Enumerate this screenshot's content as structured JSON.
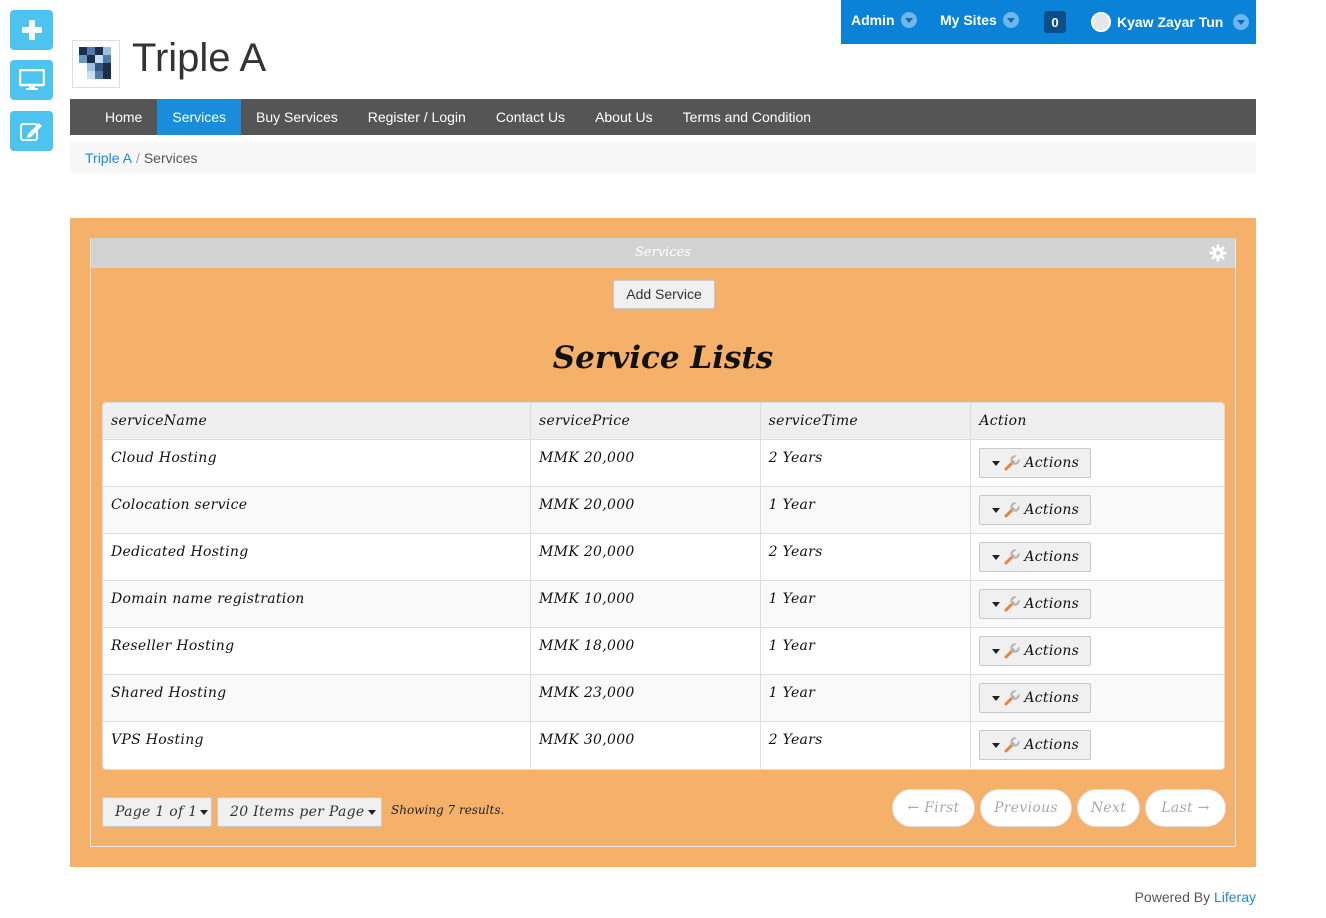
{
  "dock": {
    "add_icon": "plus-icon",
    "preview_icon": "monitor-icon",
    "edit_icon": "edit-icon"
  },
  "topbar": {
    "admin": "Admin",
    "my_sites": "My Sites",
    "notifications": "0",
    "user": "Kyaw Zayar Tun"
  },
  "site": {
    "title": "Triple A"
  },
  "nav": {
    "items": [
      "Home",
      "Services",
      "Buy Services",
      "Register / Login",
      "Contact Us",
      "About Us",
      "Terms and Condition"
    ],
    "active": "Services"
  },
  "breadcrumb": {
    "home": "Triple A",
    "separator": "/",
    "current": "Services"
  },
  "portlet": {
    "title": "Services",
    "add_button": "Add Service",
    "list_title": "Service Lists",
    "columns": [
      "serviceName",
      "servicePrice",
      "serviceTime",
      "Action"
    ],
    "rows": [
      {
        "name": "Cloud Hosting",
        "price": "MMK 20,000",
        "time": "2 Years"
      },
      {
        "name": "Colocation service",
        "price": "MMK 20,000",
        "time": "1 Year"
      },
      {
        "name": "Dedicated Hosting",
        "price": "MMK 20,000",
        "time": "2 Years"
      },
      {
        "name": "Domain name registration",
        "price": "MMK 10,000",
        "time": "1 Year"
      },
      {
        "name": "Reseller Hosting",
        "price": "MMK 18,000",
        "time": "1 Year"
      },
      {
        "name": "Shared Hosting",
        "price": "MMK 23,000",
        "time": "1 Year"
      },
      {
        "name": "VPS Hosting",
        "price": "MMK 30,000",
        "time": "2 Years"
      }
    ],
    "action_label": "Actions",
    "pagination": {
      "page": "Page 1 of 1",
      "per_page": "20 Items per Page",
      "showing": "Showing 7 results.",
      "first": "← First",
      "previous": "Previous",
      "next": "Next",
      "last": "Last →"
    }
  },
  "footer": {
    "powered_by": "Powered By",
    "link": "Liferay"
  },
  "colors": {
    "accent": "#1a8cdc",
    "topbar": "#0a82d8",
    "section_bg": "#f5b06a",
    "nav_bg": "#555555",
    "dock": "#4dc3f0"
  }
}
